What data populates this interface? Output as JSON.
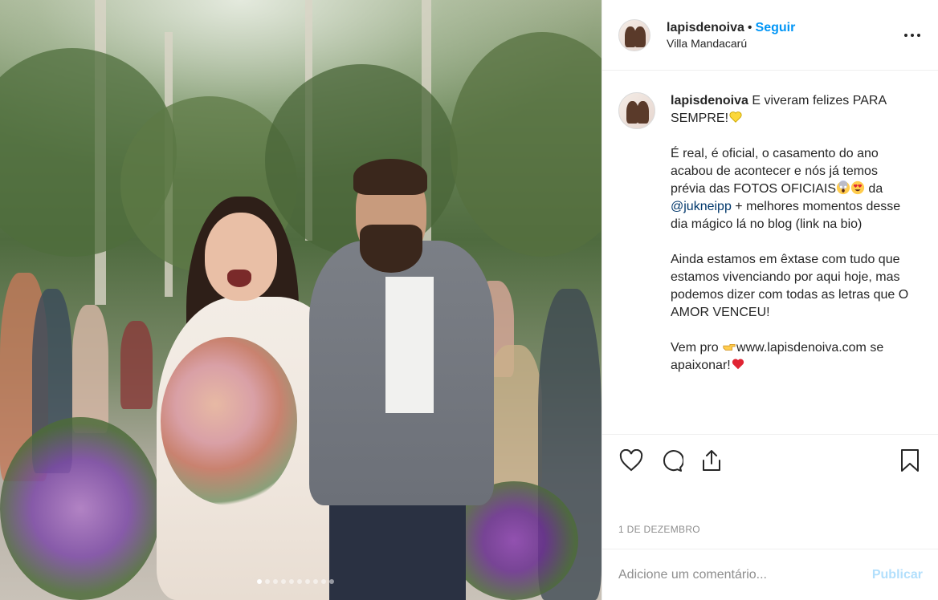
{
  "post": {
    "username": "lapisdenoiva",
    "separator": "•",
    "follow_label": "Seguir",
    "location": "Villa Mandacarú",
    "more_icon": "more-horizontal-icon",
    "caption": {
      "username": "lapisdenoiva",
      "line1": "E viveram felizes PARA SEMPRE!",
      "line1_emoji": "yellow-heart",
      "p2_part1": "É real, é oficial, o casamento do ano acabou de acontecer e nós já temos prévia das FOTOS OFICIAIS",
      "p2_emojis": [
        "screaming-face",
        "heart-eyes-face"
      ],
      "p2_part2": " da ",
      "mention": "@jukneipp",
      "p2_part3": " + melhores momentos desse dia mágico lá no blog (link na bio)",
      "p3": "Ainda estamos em êxtase com tudo que estamos vivenciando por aqui hoje, mas podemos dizer com todas as letras que O AMOR VENCEU!",
      "p4_part1": "Vem pro ",
      "p4_emoji": "pointing-right-hand",
      "p4_part2": "www.lapisdenoiva.com se apaixonar!",
      "p4_end_emoji": "red-heart"
    },
    "date": "1 de dezembro",
    "comment_placeholder": "Adicione um comentário...",
    "post_label": "Publicar",
    "carousel": {
      "total": 10,
      "active": 1
    }
  },
  "colors": {
    "link_blue": "#0095f6",
    "mention": "#00376b",
    "muted": "#8e8e8e",
    "publish_disabled": "#b2dffc",
    "border": "#efefef"
  }
}
